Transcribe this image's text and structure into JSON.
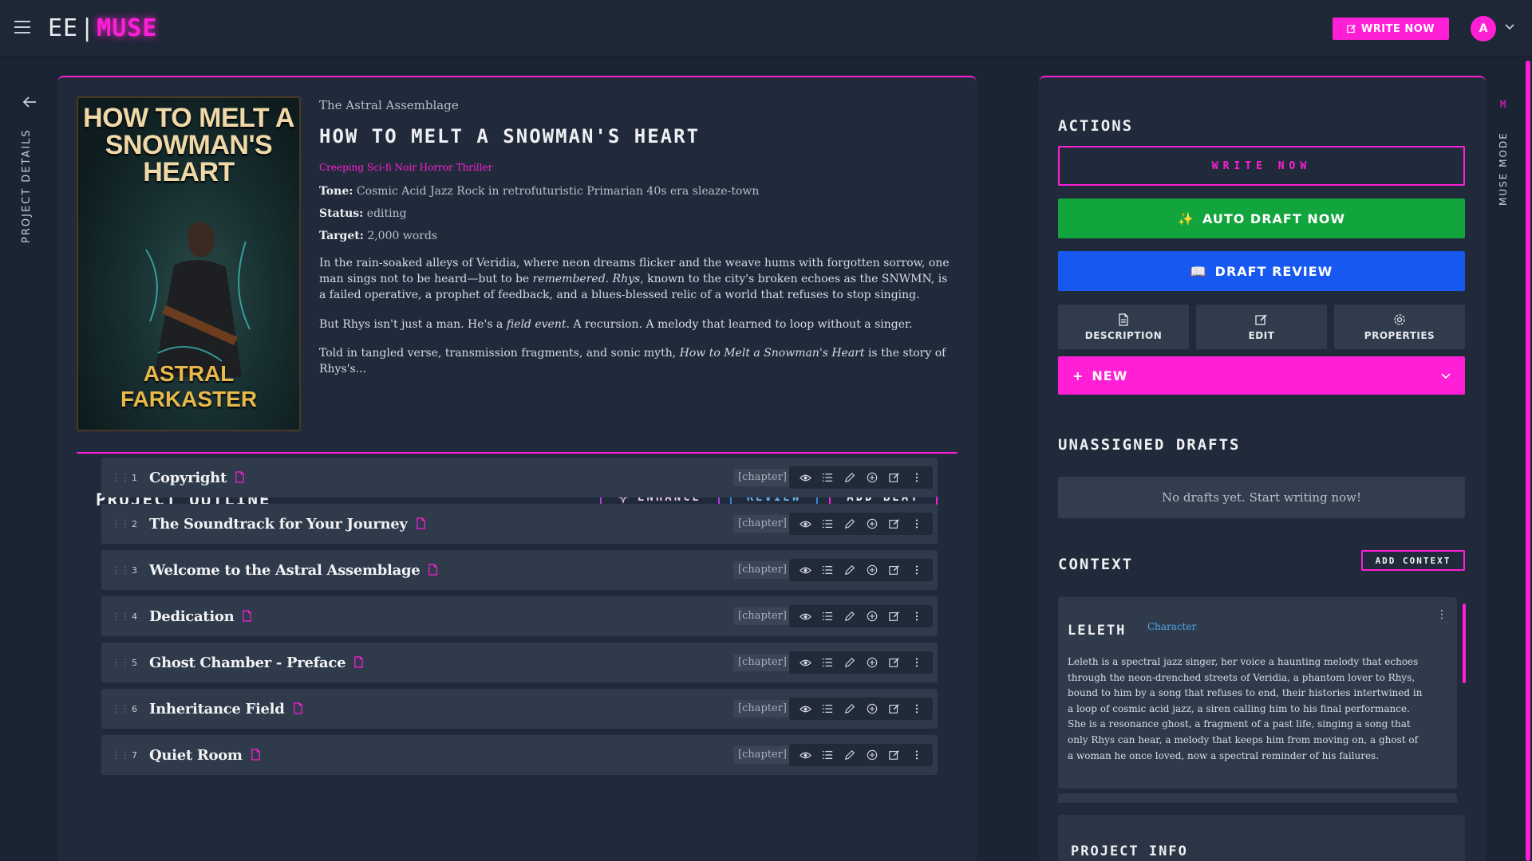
{
  "topbar": {
    "logo_left": "EE",
    "logo_sep": "|",
    "logo_right": "MUSE",
    "write_now": "WRITE NOW",
    "avatar_initial": "A"
  },
  "rails": {
    "left_label": "PROJECT DETAILS",
    "right_label": "MUSE MODE",
    "right_icon": "M"
  },
  "project": {
    "cover_title": "HOW TO MELT A SNOWMAN'S HEART",
    "cover_author": "ASTRAL FARKASTER",
    "series": "The Astral Assemblage",
    "title": "HOW TO MELT A SNOWMAN'S HEART",
    "genre": "Creeping Sci-fi Noir Horror Thriller",
    "tone_label": "Tone:",
    "tone": "Cosmic Acid Jazz Rock in retrofuturistic Primarian 40s era sleaze-town",
    "status_label": "Status:",
    "status": "editing",
    "target_label": "Target:",
    "target": "2,000 words",
    "p1_a": "In the rain-soaked alleys of Veridia, where neon dreams flicker and the weave hums with forgotten sorrow, one man sings not to be heard—but to be ",
    "p1_i": "remembered. Rhys",
    "p1_b": ", known to the city's broken echoes as the SNWMN, is a failed operative, a prophet of feedback, and a blues-blessed relic of a world that refuses to stop singing.",
    "p2_a": "But Rhys isn't just a man. He's a ",
    "p2_i": "field event",
    "p2_b": ". A recursion. A melody that learned to loop without a singer.",
    "p3_a": "Told in tangled verse, transmission fragments, and sonic myth, ",
    "p3_i": "How to Melt a Snowman's Heart",
    "p3_b": " is the story of Rhys's..."
  },
  "outline": {
    "heading": "PROJECT OUTLINE",
    "enhance": "ENHANCE",
    "review": "REVIEW",
    "add_beat": "ADD BEAT",
    "rows": [
      {
        "num": "1",
        "title": "Copyright",
        "tag": "[chapter]"
      },
      {
        "num": "2",
        "title": "The Soundtrack for Your Journey",
        "tag": "[chapter]"
      },
      {
        "num": "3",
        "title": "Welcome to the Astral Assemblage",
        "tag": "[chapter]"
      },
      {
        "num": "4",
        "title": "Dedication",
        "tag": "[chapter]"
      },
      {
        "num": "5",
        "title": "Ghost Chamber - Preface",
        "tag": "[chapter]"
      },
      {
        "num": "6",
        "title": "Inheritance Field",
        "tag": "[chapter]"
      },
      {
        "num": "7",
        "title": "Quiet Room",
        "tag": "[chapter]"
      }
    ]
  },
  "actions": {
    "heading": "ACTIONS",
    "write_now": "WRITE NOW",
    "auto_draft": "AUTO DRAFT NOW",
    "draft_review": "DRAFT REVIEW",
    "description": "DESCRIPTION",
    "edit": "EDIT",
    "properties": "PROPERTIES",
    "new": "NEW"
  },
  "drafts": {
    "heading": "UNASSIGNED DRAFTS",
    "empty": "No drafts yet. Start writing now!"
  },
  "context": {
    "heading": "CONTEXT",
    "add": "ADD CONTEXT",
    "name": "LELETH",
    "type": "Character",
    "text": "Leleth is a spectral jazz singer, her voice a haunting melody that echoes through the neon-drenched streets of Veridia, a phantom lover to Rhys, bound to him by a song that refuses to end, their histories intertwined in a loop of cosmic acid jazz, a siren calling him to his final performance. She is a resonance ghost, a fragment of a past life, singing a song that only Rhys can hear, a melody that keeps him from moving on, a ghost of a woman he once loved, now a spectral reminder of his failures."
  },
  "project_info": {
    "heading": "PROJECT INFO"
  },
  "colors": {
    "accent": "#ff1fd6",
    "green": "#12a43d",
    "blue": "#1758f0",
    "panel": "#202a3a"
  }
}
